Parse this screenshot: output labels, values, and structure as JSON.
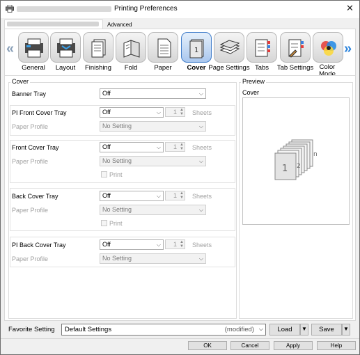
{
  "window": {
    "title": "Printing Preferences",
    "close_icon": "close-icon"
  },
  "tabs": [
    {
      "label": "",
      "active": true
    },
    {
      "label": "Advanced",
      "active": false
    }
  ],
  "toolbar": {
    "items": [
      {
        "label": "General",
        "icon": "general-icon"
      },
      {
        "label": "Layout",
        "icon": "layout-icon"
      },
      {
        "label": "Finishing",
        "icon": "finishing-icon"
      },
      {
        "label": "Fold",
        "icon": "fold-icon"
      },
      {
        "label": "Paper",
        "icon": "paper-icon"
      },
      {
        "label": "Cover",
        "icon": "cover-icon",
        "selected": true
      },
      {
        "label": "Page Settings",
        "icon": "page-settings-icon"
      },
      {
        "label": "Tabs",
        "icon": "tabs-icon"
      },
      {
        "label": "Tab Settings",
        "icon": "tab-settings-icon"
      },
      {
        "label": "Color Mode",
        "icon": "color-mode-icon"
      }
    ]
  },
  "cover": {
    "section_title": "Cover",
    "banner_tray": {
      "label": "Banner Tray",
      "value": "Off"
    },
    "pi_front": {
      "label": "PI Front Cover Tray",
      "value": "Off",
      "sheets_value": "1",
      "sheets_label": "Sheets",
      "profile_label": "Paper Profile",
      "profile_value": "No Setting"
    },
    "front": {
      "label": "Front Cover Tray",
      "value": "Off",
      "sheets_value": "1",
      "sheets_label": "Sheets",
      "profile_label": "Paper Profile",
      "profile_value": "No Setting",
      "print_label": "Print"
    },
    "back": {
      "label": "Back Cover Tray",
      "value": "Off",
      "sheets_value": "1",
      "sheets_label": "Sheets",
      "profile_label": "Paper Profile",
      "profile_value": "No Setting",
      "print_label": "Print"
    },
    "pi_back": {
      "label": "PI Back Cover Tray",
      "value": "Off",
      "sheets_value": "1",
      "sheets_label": "Sheets",
      "profile_label": "Paper Profile",
      "profile_value": "No Setting"
    }
  },
  "preview": {
    "title": "Preview",
    "subtitle": "Cover",
    "page_numbers": [
      "1",
      "2",
      "n"
    ]
  },
  "footer": {
    "favorite_label": "Favorite Setting",
    "favorite_value": "Default Settings",
    "favorite_modified": "(modified)",
    "load_label": "Load",
    "save_label": "Save",
    "ok_label": "OK",
    "cancel_label": "Cancel",
    "apply_label": "Apply",
    "help_label": "Help"
  },
  "colors": {
    "accent": "#2c84dc",
    "selected_border": "#3f7cc9"
  }
}
